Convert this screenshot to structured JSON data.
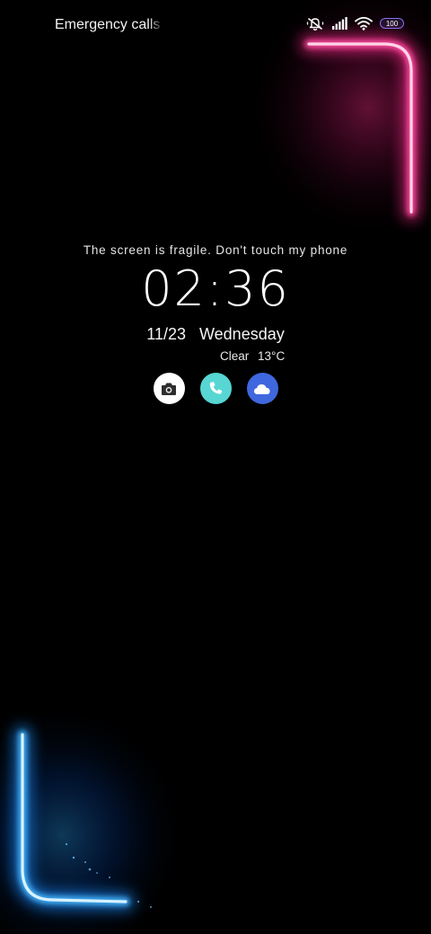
{
  "status_bar": {
    "carrier_text": "Emergency calls only",
    "battery_level": "100",
    "icons": [
      "vibrate-off-icon",
      "signal-icon",
      "wifi-icon",
      "battery-icon"
    ]
  },
  "lock_screen": {
    "motto": "The screen is fragile. Don't touch my phone",
    "time": "02:36",
    "date": "11/23",
    "weekday": "Wednesday",
    "weather_condition": "Clear",
    "temperature": "13°C"
  },
  "shortcuts": [
    {
      "name": "camera",
      "icon": "camera-icon",
      "bg_color": "#ffffff"
    },
    {
      "name": "phone",
      "icon": "phone-icon",
      "bg_color": "#57d6d3"
    },
    {
      "name": "weather",
      "icon": "cloud-icon",
      "bg_color": "#3f67de"
    }
  ],
  "theme": {
    "top_accent": "#ff2b8c",
    "bottom_accent": "#2aa7ff",
    "background": "#000000"
  }
}
